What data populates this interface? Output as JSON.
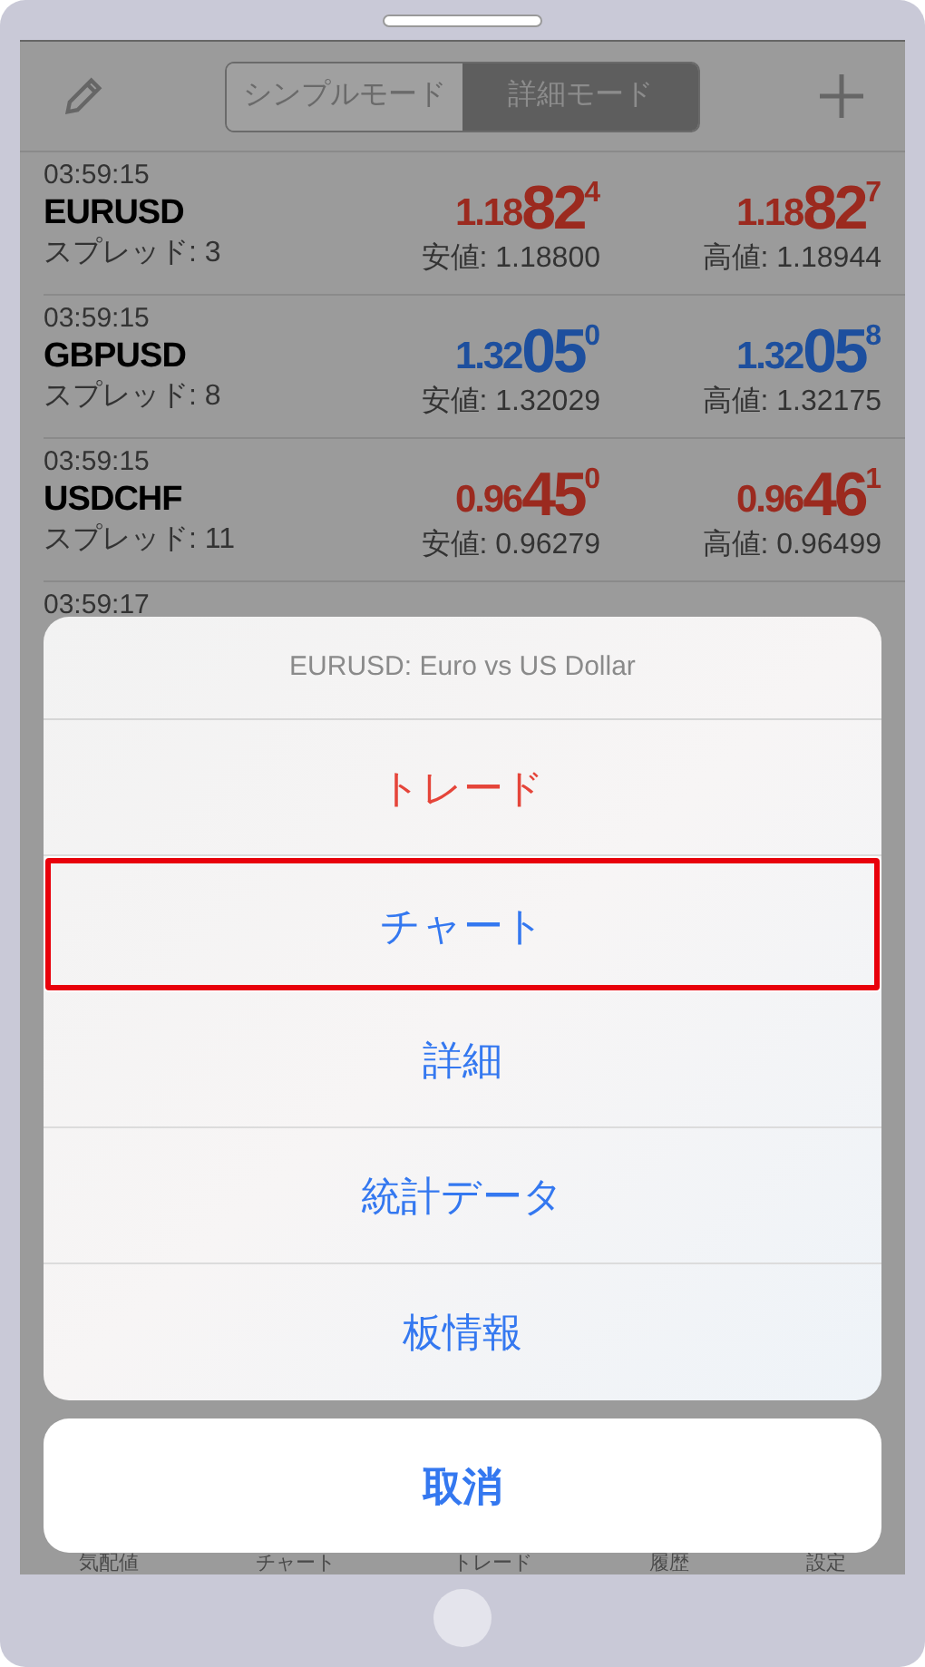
{
  "nav": {
    "segments": [
      {
        "label": "シンプルモード",
        "selected": false
      },
      {
        "label": "詳細モード",
        "selected": true
      }
    ]
  },
  "quotes": [
    {
      "time": "03:59:15",
      "symbol": "EURUSD",
      "spread": "スプレッド: 3",
      "color": "#9b2a1f",
      "bid": {
        "prefix": "1.18",
        "big": "82",
        "sup": "4"
      },
      "ask": {
        "prefix": "1.18",
        "big": "82",
        "sup": "7"
      },
      "low": "安値: 1.18800",
      "high": "高値: 1.18944"
    },
    {
      "time": "03:59:15",
      "symbol": "GBPUSD",
      "spread": "スプレッド: 8",
      "color": "#1d4f9e",
      "bid": {
        "prefix": "1.32",
        "big": "05",
        "sup": "0"
      },
      "ask": {
        "prefix": "1.32",
        "big": "05",
        "sup": "8"
      },
      "low": "安値: 1.32029",
      "high": "高値: 1.32175"
    },
    {
      "time": "03:59:15",
      "symbol": "USDCHF",
      "spread": "スプレッド: 11",
      "color": "#9b2a1f",
      "bid": {
        "prefix": "0.96",
        "big": "45",
        "sup": "0"
      },
      "ask": {
        "prefix": "0.96",
        "big": "46",
        "sup": "1"
      },
      "low": "安値: 0.96279",
      "high": "高値: 0.96499"
    }
  ],
  "partial_row": {
    "time": "03:59:17"
  },
  "action_sheet": {
    "title": "EURUSD: Euro vs US Dollar",
    "items": [
      {
        "label": "トレード",
        "kind": "destructive",
        "highlighted": false
      },
      {
        "label": "チャート",
        "kind": "default",
        "highlighted": true
      },
      {
        "label": "詳細",
        "kind": "default",
        "highlighted": false
      },
      {
        "label": "統計データ",
        "kind": "default",
        "highlighted": false
      },
      {
        "label": "板情報",
        "kind": "default",
        "highlighted": false
      }
    ],
    "cancel": "取消"
  },
  "tab_bar": [
    "気配値",
    "チャート",
    "トレード",
    "履歴",
    "設定"
  ]
}
